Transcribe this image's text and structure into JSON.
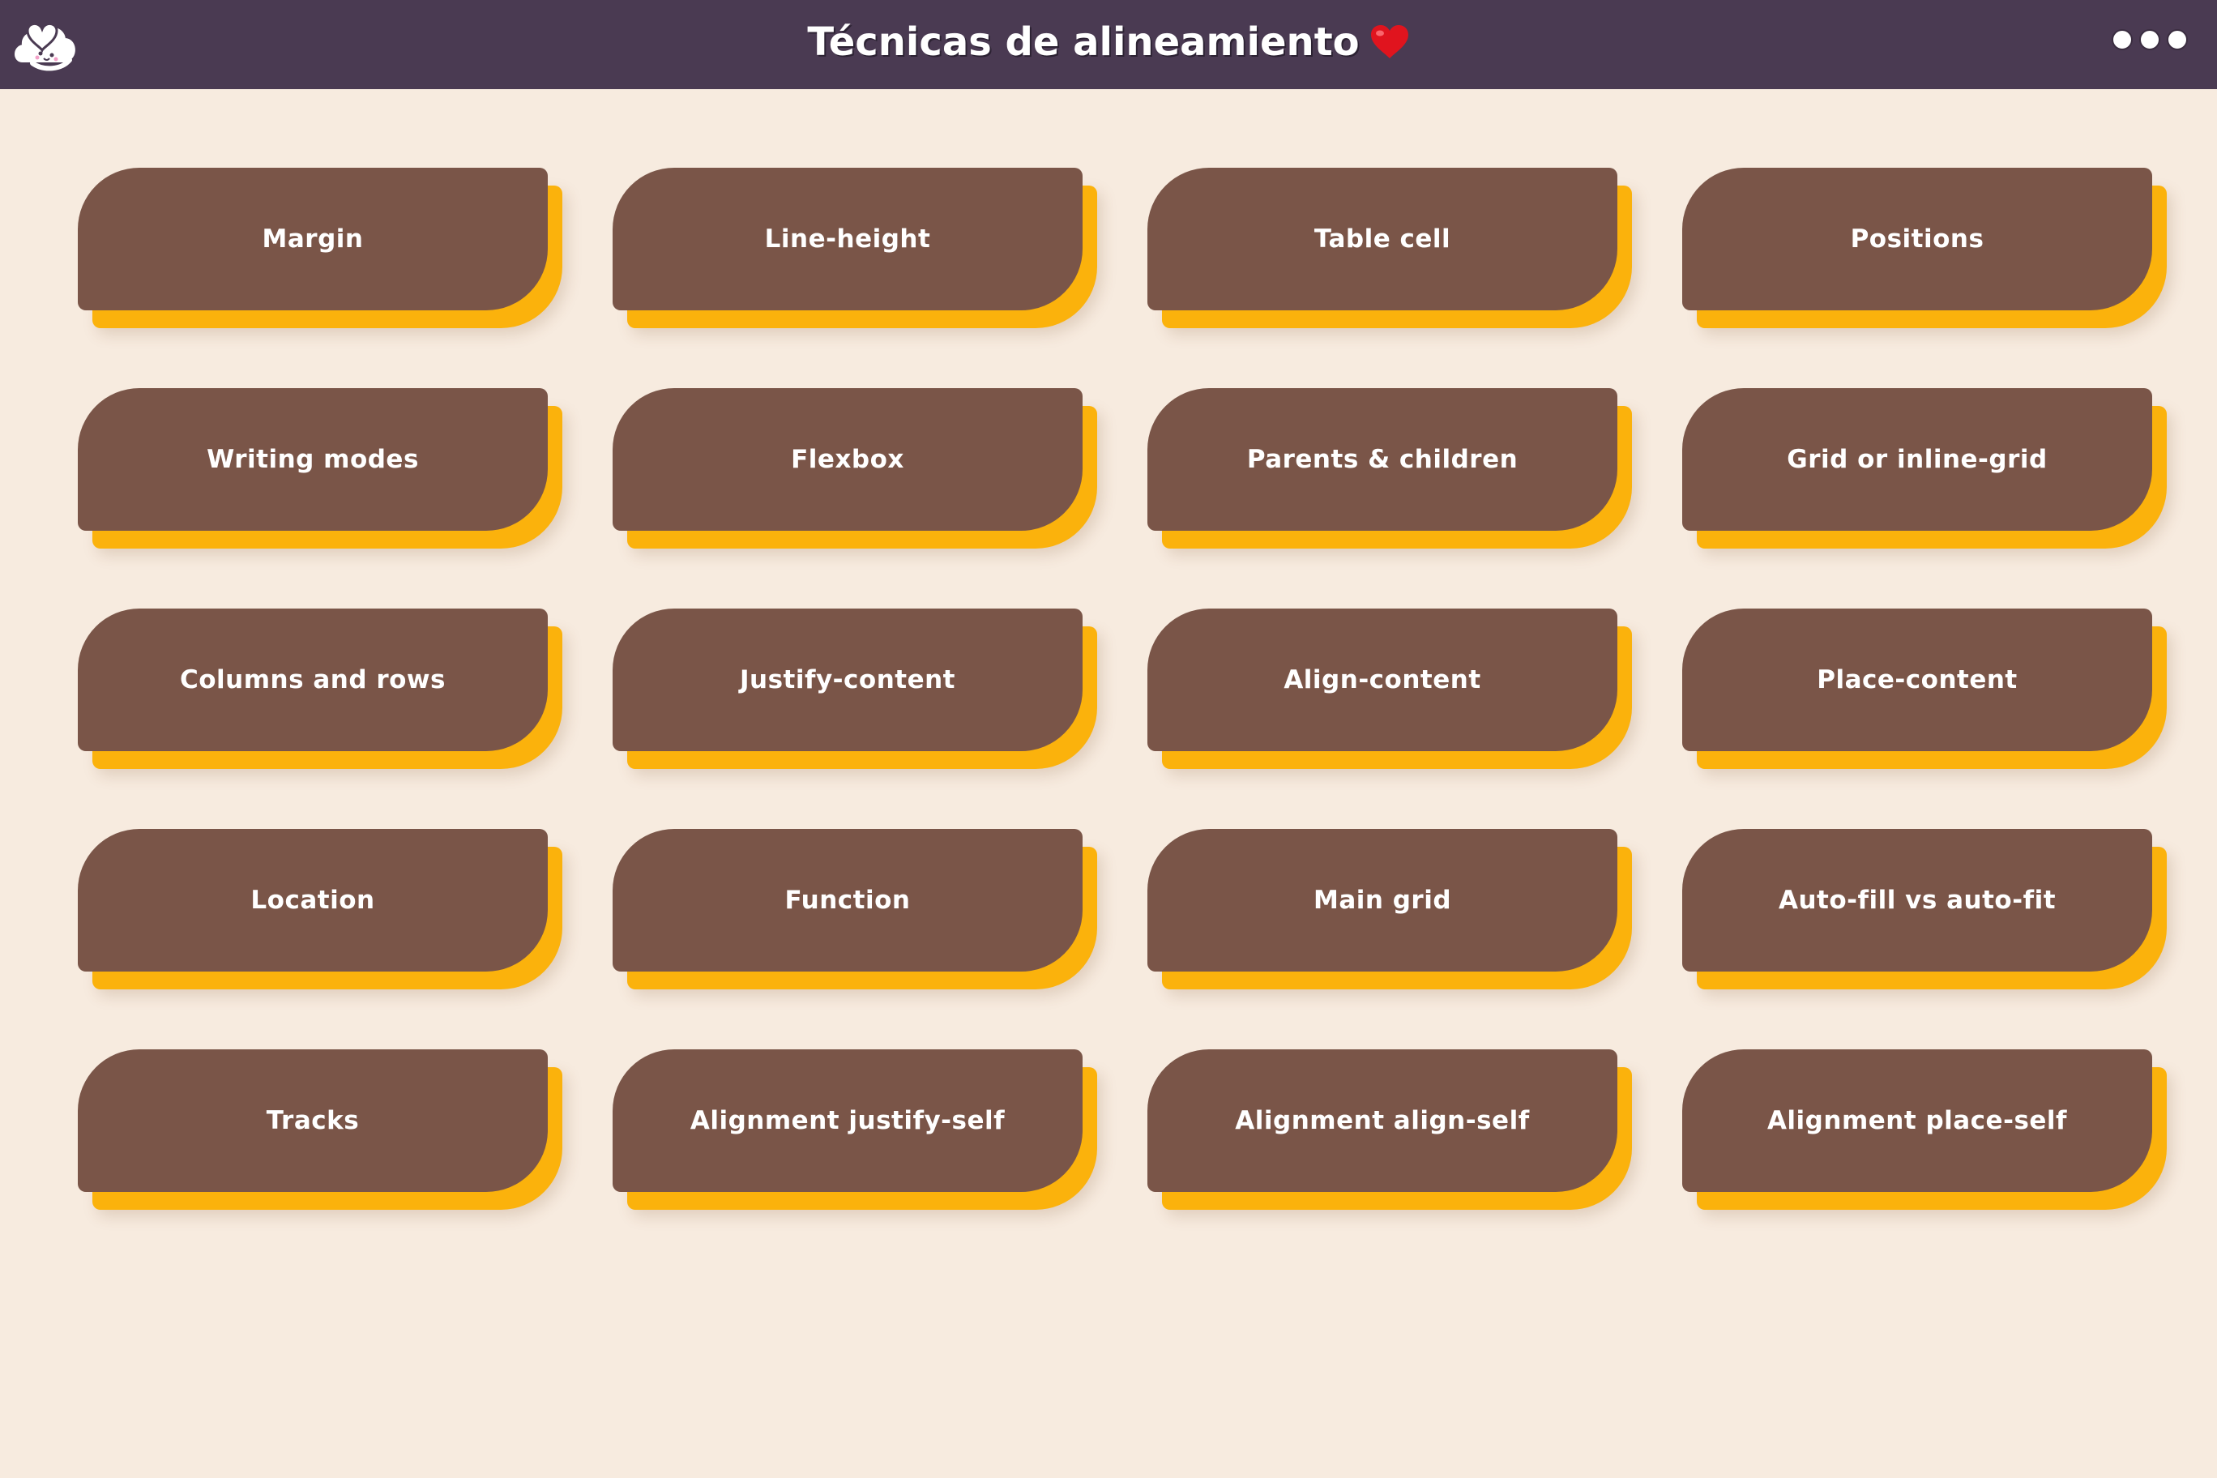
{
  "header": {
    "title": "Técnicas de alineamiento",
    "logo_icon": "cloud-heart-icon",
    "title_icon": "heart-icon",
    "menu_icon": "more-dots-icon",
    "background_color": "#4a3a52"
  },
  "cards": [
    {
      "label": "Margin"
    },
    {
      "label": "Line-height"
    },
    {
      "label": "Table cell"
    },
    {
      "label": "Positions"
    },
    {
      "label": "Writing modes"
    },
    {
      "label": "Flexbox"
    },
    {
      "label": "Parents & children"
    },
    {
      "label": "Grid or inline-grid"
    },
    {
      "label": "Columns and rows"
    },
    {
      "label": "Justify-content"
    },
    {
      "label": "Align-content"
    },
    {
      "label": "Place-content"
    },
    {
      "label": "Location"
    },
    {
      "label": "Function"
    },
    {
      "label": "Main grid"
    },
    {
      "label": "Auto-fill vs auto-fit"
    },
    {
      "label": "Tracks"
    },
    {
      "label": "Alignment justify-self"
    },
    {
      "label": "Alignment align-self"
    },
    {
      "label": "Alignment place-self"
    }
  ],
  "colors": {
    "page_background": "#f7ebdf",
    "card": "#7a5548",
    "card_shadow": "#fbb20c",
    "heart": "#e0141e"
  }
}
